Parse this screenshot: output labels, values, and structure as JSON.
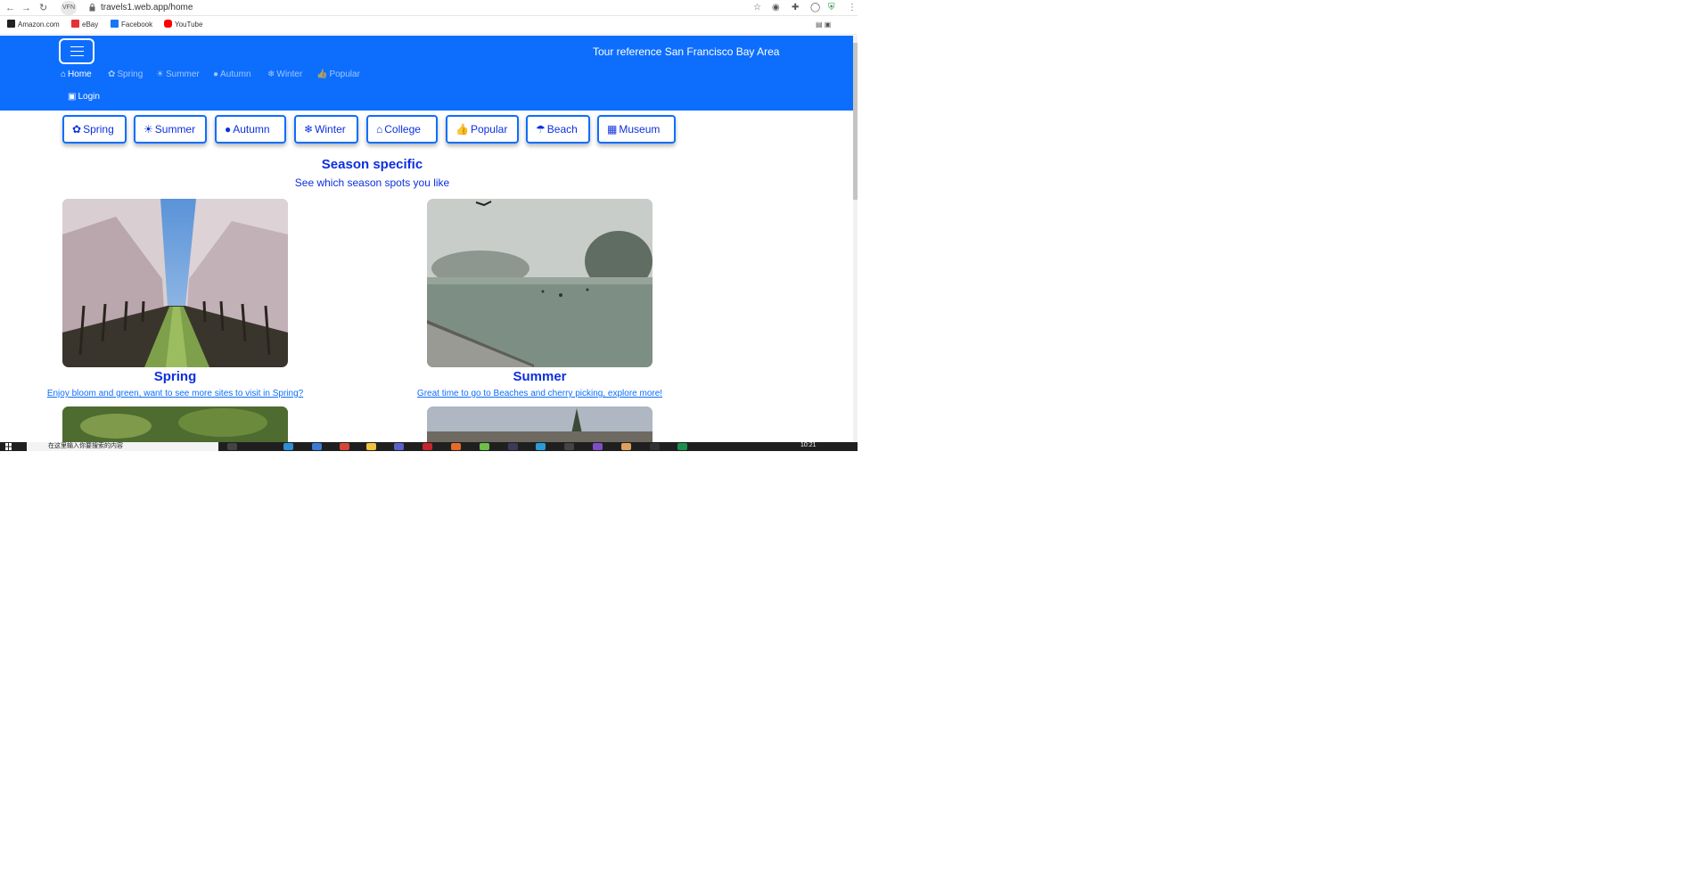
{
  "browser": {
    "url": "travels1.web.app/home",
    "site_pill": "VFN",
    "bookmarks": [
      {
        "label": "Amazon.com",
        "color": "#222222"
      },
      {
        "label": "eBay",
        "color": "#e53238"
      },
      {
        "label": "Facebook",
        "color": "#1877f2"
      },
      {
        "label": "YouTube",
        "color": "#ff0000"
      }
    ]
  },
  "navbar": {
    "brand": "Tour reference San Francisco Bay Area",
    "links": [
      {
        "icon": "home-icon",
        "glyph": "⌂",
        "label": "Home"
      },
      {
        "icon": "flower-icon",
        "glyph": "✿",
        "label": "Spring"
      },
      {
        "icon": "sun-icon",
        "glyph": "☀",
        "label": "Summer"
      },
      {
        "icon": "apple-icon",
        "glyph": "●",
        "label": "Autumn"
      },
      {
        "icon": "snowflake-icon",
        "glyph": "❄",
        "label": "Winter"
      },
      {
        "icon": "thumbs-up-icon",
        "glyph": "👍",
        "label": "Popular"
      }
    ],
    "login": "Login",
    "bg_color": "#0d6efd"
  },
  "categories": [
    {
      "icon": "flower-icon",
      "glyph": "✿",
      "label": "Spring"
    },
    {
      "icon": "sun-icon",
      "glyph": "☀",
      "label": "Summer"
    },
    {
      "icon": "apple-icon",
      "glyph": "●",
      "label": "Autumn"
    },
    {
      "icon": "snowflake-icon",
      "glyph": "❄",
      "label": "Winter"
    },
    {
      "icon": "building-icon",
      "glyph": "⌂",
      "label": "College"
    },
    {
      "icon": "thumbs-up-icon",
      "glyph": "👍",
      "label": "Popular"
    },
    {
      "icon": "umbrella-icon",
      "glyph": "☂",
      "label": "Beach"
    },
    {
      "icon": "museum-icon",
      "glyph": "▦",
      "label": "Museum"
    }
  ],
  "section": {
    "title": "Season specific",
    "subtitle": "See which season spots you like"
  },
  "cards": [
    {
      "title": "Spring",
      "link": "Enjoy bloom and green, want to see more sites to visit in Spring?",
      "image": "orchard-photo"
    },
    {
      "title": "Summer",
      "link": "Great time to go to Beaches and cherry picking, explore more!",
      "image": "foggy-lake-photo"
    }
  ],
  "taskbar": {
    "search_placeholder": "在这里输入你要搜索的内容",
    "time": "10:21"
  }
}
